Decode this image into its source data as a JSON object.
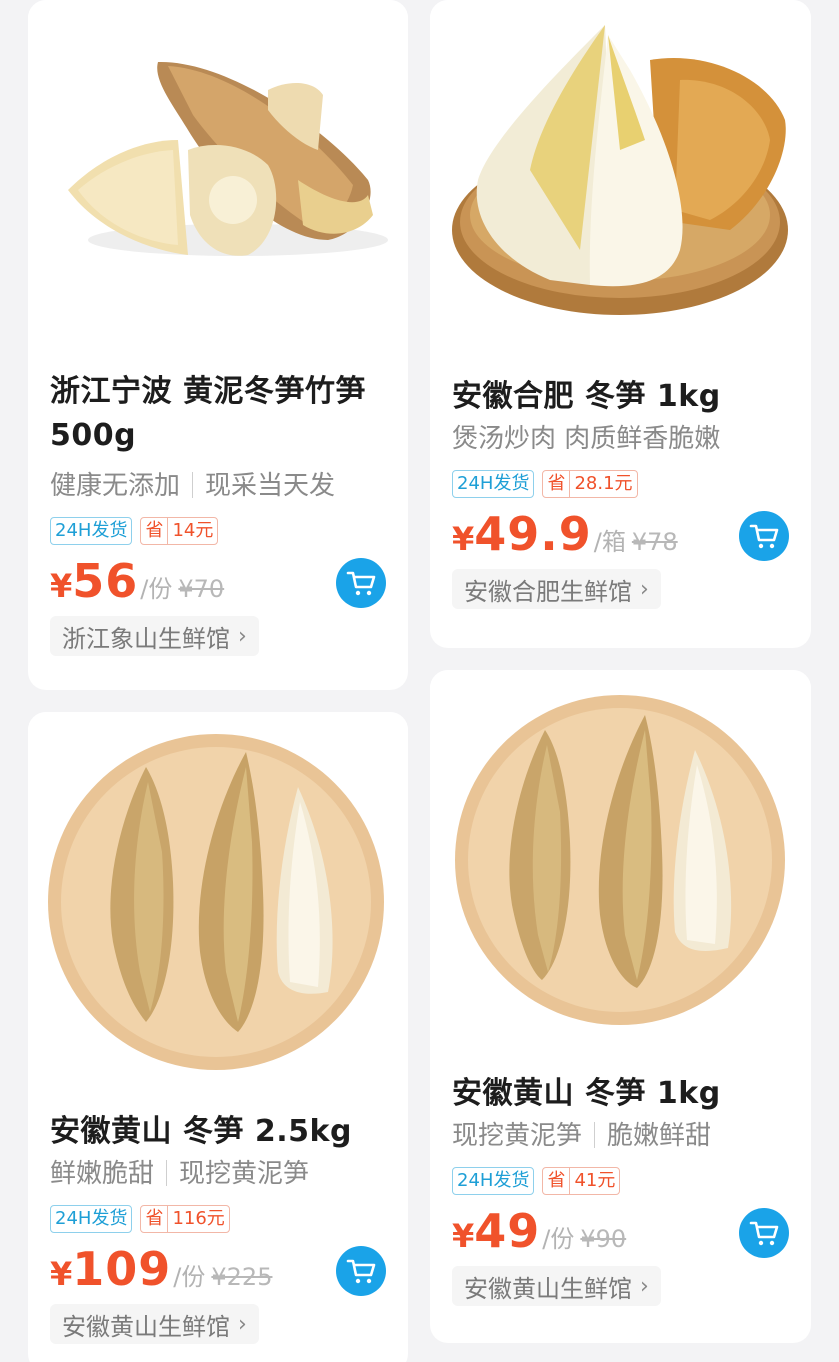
{
  "products": [
    {
      "title": "浙江宁波  黄泥冬笋竹笋500g",
      "subtitle_a": "健康无添加",
      "subtitle_b": "现采当天发",
      "ship_tag": "24H发货",
      "save_label": "省",
      "save_amount": "14元",
      "currency": "¥",
      "price": "56",
      "unit": "/份",
      "original_price": "¥70",
      "shop": "浙江象山生鲜馆",
      "image_icon": "bamboo-shoot-cut-icon"
    },
    {
      "title": "安徽合肥 冬笋 1kg",
      "subtitle_a": "煲汤炒肉 肉质鲜香脆嫩",
      "subtitle_b": "",
      "ship_tag": "24H发货",
      "save_label": "省",
      "save_amount": "28.1元",
      "currency": "¥",
      "price": "49.9",
      "unit": "/箱",
      "original_price": "¥78",
      "shop": "安徽合肥生鲜馆",
      "image_icon": "bamboo-shoot-basket-icon"
    },
    {
      "title": "安徽黄山 冬笋 2.5kg",
      "subtitle_a": "鲜嫩脆甜",
      "subtitle_b": "现挖黄泥笋",
      "ship_tag": "24H发货",
      "save_label": "省",
      "save_amount": "116元",
      "currency": "¥",
      "price": "109",
      "unit": "/份",
      "original_price": "¥225",
      "shop": "安徽黄山生鲜馆",
      "image_icon": "bamboo-shoot-plate-icon"
    },
    {
      "title": "安徽黄山 冬笋 1kg",
      "subtitle_a": "现挖黄泥笋",
      "subtitle_b": "脆嫩鲜甜",
      "ship_tag": "24H发货",
      "save_label": "省",
      "save_amount": "41元",
      "currency": "¥",
      "price": "49",
      "unit": "/份",
      "original_price": "¥90",
      "shop": "安徽黄山生鲜馆",
      "image_icon": "bamboo-shoot-plate-icon"
    }
  ],
  "colors": {
    "price": "#f0522b",
    "cart": "#1aa3e8",
    "ship_tag": "#1e9fd6"
  }
}
